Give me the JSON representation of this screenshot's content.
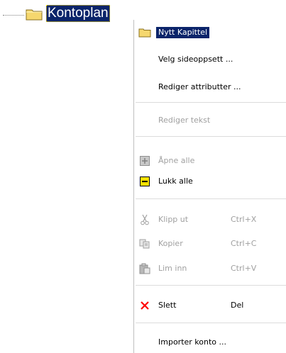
{
  "tree": {
    "node_label": "Kontoplan",
    "node_icon": "folder-icon"
  },
  "menu": {
    "items": [
      {
        "label": "Nytt Kapittel",
        "icon": "folder-icon",
        "enabled": true,
        "selected": true
      },
      {
        "label": "Velg sideoppsett ...",
        "enabled": true
      },
      {
        "label": "Rediger attributter ...",
        "enabled": true
      },
      {
        "label": "Rediger tekst",
        "enabled": false
      },
      {
        "label": "Åpne alle",
        "icon": "expand-icon",
        "enabled": false
      },
      {
        "label": "Lukk alle",
        "icon": "collapse-icon",
        "enabled": true
      },
      {
        "label": "Klipp ut",
        "shortcut": "Ctrl+X",
        "icon": "scissors-icon",
        "enabled": false
      },
      {
        "label": "Kopier",
        "shortcut": "Ctrl+C",
        "icon": "copy-icon",
        "enabled": false
      },
      {
        "label": "Lim inn",
        "shortcut": "Ctrl+V",
        "icon": "paste-icon",
        "enabled": false
      },
      {
        "label": "Slett",
        "shortcut": "Del",
        "icon": "delete-icon",
        "enabled": true
      },
      {
        "label": "Importer konto ...",
        "enabled": true
      }
    ]
  },
  "colors": {
    "selection": "#0a246a",
    "disabled_text": "#a0a0a0",
    "folder": "#f5d76e",
    "delete": "#ff0000"
  }
}
